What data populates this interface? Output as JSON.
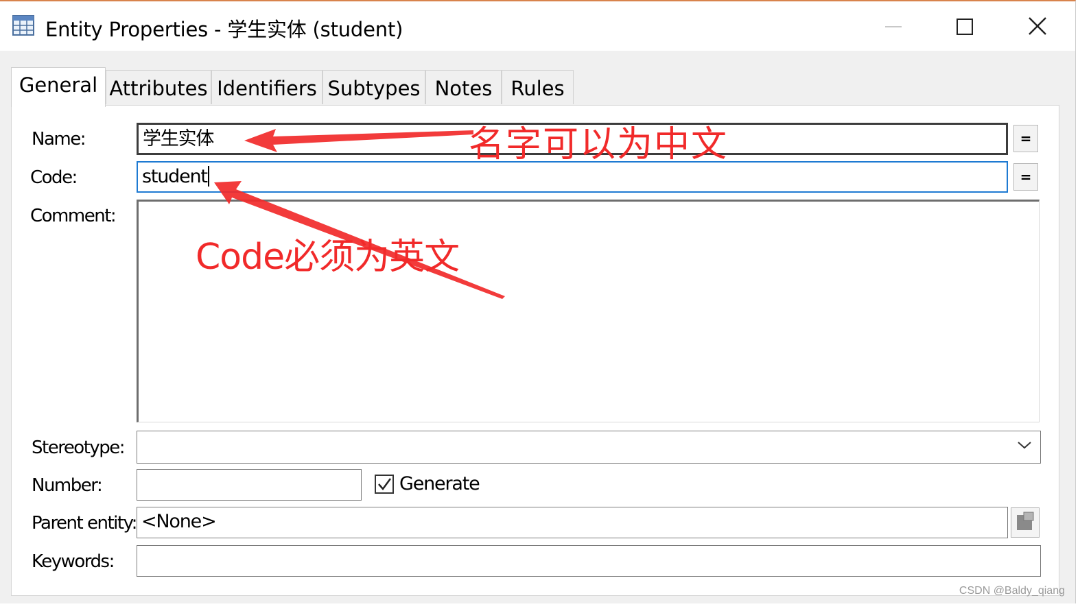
{
  "window": {
    "title": "Entity Properties - 学生实体 (student)",
    "title_icon": "table-grid-icon",
    "controls": {
      "minimize": "minimize-icon",
      "maximize": "maximize-icon",
      "close": "close-icon"
    }
  },
  "tabs": [
    {
      "label": "General",
      "active": true
    },
    {
      "label": "Attributes",
      "active": false
    },
    {
      "label": "Identifiers",
      "active": false
    },
    {
      "label": "Subtypes",
      "active": false
    },
    {
      "label": "Notes",
      "active": false
    },
    {
      "label": "Rules",
      "active": false
    }
  ],
  "form": {
    "name": {
      "label": "Name:",
      "value": "学生实体",
      "button": "="
    },
    "code": {
      "label": "Code:",
      "value": "student",
      "button": "="
    },
    "comment": {
      "label": "Comment:",
      "value": ""
    },
    "stereotype": {
      "label": "Stereotype:",
      "value": ""
    },
    "number": {
      "label": "Number:",
      "value": ""
    },
    "generate": {
      "label": "Generate",
      "checked": true
    },
    "parent_entity": {
      "label": "Parent entity:",
      "value": "<None>"
    },
    "keywords": {
      "label": "Keywords:",
      "value": ""
    }
  },
  "annotations": {
    "name_note": "名字可以为中文",
    "code_note": "Code必须为英文",
    "color": "#f12a2a"
  },
  "watermark": "CSDN @Baldy_qiang"
}
